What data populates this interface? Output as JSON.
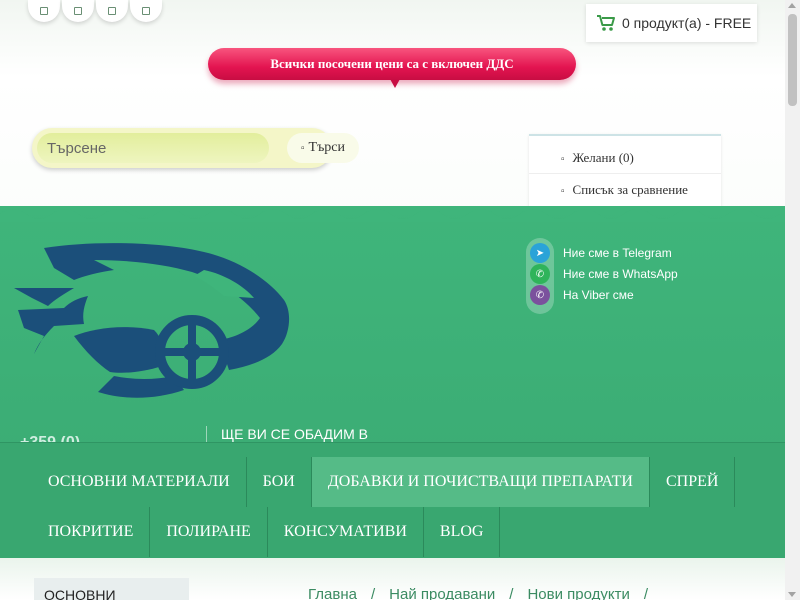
{
  "colors": {
    "brand_green": "#3fb57b",
    "banner_red": "#e31450",
    "logo_navy": "#1b4f7a"
  },
  "social_top": [
    "square-icon",
    "square-icon",
    "square-icon",
    "square-icon"
  ],
  "cart": {
    "icon": "cart-icon",
    "text": "0 продукт(а) - FREE"
  },
  "vat_notice": "Всички посочени цени са с включен ДДС",
  "search": {
    "placeholder": "Търсене",
    "button_label": "Търси",
    "button_icon": "search-icon"
  },
  "wishlist": {
    "wish_label": "Желани (0)",
    "compare_label": "Списък за сравнение"
  },
  "social_links": [
    {
      "icon": "telegram-icon",
      "label": "Ние сме в Telegram",
      "color": "#2aa3d8"
    },
    {
      "icon": "whatsapp-icon",
      "label": "Ние сме в WhatsApp",
      "color": "#2fb45a"
    },
    {
      "icon": "viber-icon",
      "label": "На Viber сме",
      "color": "#7b519d"
    }
  ],
  "header": {
    "logo_icon": "car-logo-icon",
    "phone": "+359 (0)",
    "callback": "ЩЕ ВИ СЕ ОБАДИМ В"
  },
  "menu": {
    "row1": [
      "ОСНОВНИ МАТЕРИАЛИ",
      "БОИ",
      "ДОБАВКИ И ПОЧИСТВАЩИ ПРЕПАРАТИ",
      "СПРЕЙ"
    ],
    "row2": [
      "ПОКРИТИЕ",
      "ПОЛИРАНЕ",
      "КОНСУМАТИВИ",
      "BLOG"
    ]
  },
  "categories_title": "ОСНОВНИ",
  "breadcrumb": [
    "Главна",
    "Най продавани",
    "Нови продукти"
  ]
}
